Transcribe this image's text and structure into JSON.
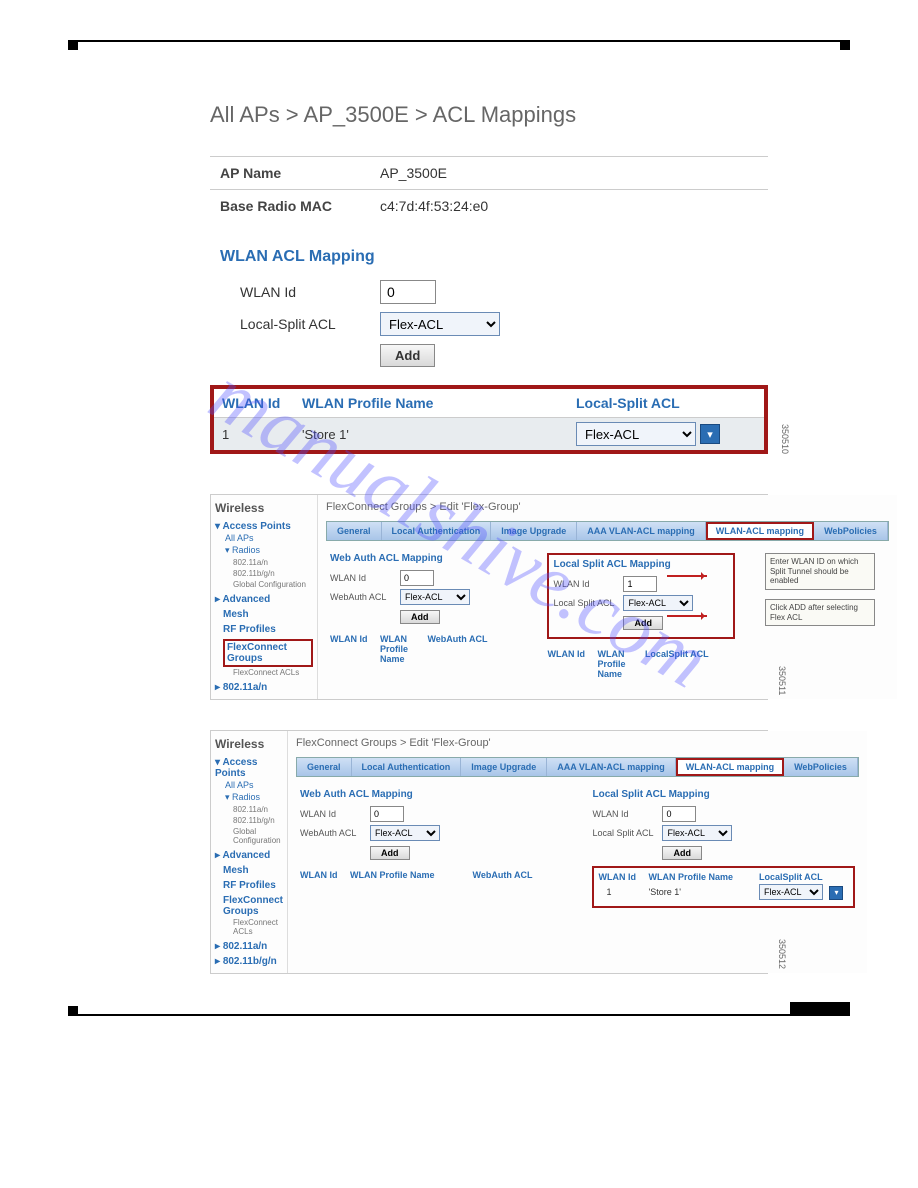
{
  "watermark": "manualshive.com",
  "shot1": {
    "breadcrumb": "All APs > AP_3500E > ACL Mappings",
    "info": {
      "ap_name_label": "AP Name",
      "ap_name_value": "AP_3500E",
      "mac_label": "Base Radio MAC",
      "mac_value": "c4:7d:4f:53:24:e0"
    },
    "section_title": "WLAN ACL Mapping",
    "wlan_id_label": "WLAN Id",
    "wlan_id_value": "0",
    "split_label": "Local-Split ACL",
    "split_value": "Flex-ACL",
    "add_btn": "Add",
    "table": {
      "h_id": "WLAN Id",
      "h_name": "WLAN Profile Name",
      "h_acl": "Local-Split ACL",
      "row": {
        "id": "1",
        "name": "'Store 1'",
        "acl": "Flex-ACL"
      }
    },
    "sidenum": "350510"
  },
  "side": {
    "title": "Wireless",
    "ap": "Access Points",
    "all_aps": "All APs",
    "radios": "Radios",
    "r1": "802.11a/n",
    "r2": "802.11b/g/n",
    "gc": "Global Configuration",
    "adv": "Advanced",
    "mesh": "Mesh",
    "rf": "RF Profiles",
    "fc": "FlexConnect Groups",
    "fca": "FlexConnect ACLs",
    "b1": "802.11a/n",
    "b2": "802.11b/g/n"
  },
  "panel2": {
    "breadcrumb": "FlexConnect Groups > Edit    'Flex-Group'",
    "tabs": [
      "General",
      "Local Authentication",
      "Image Upgrade",
      "AAA VLAN-ACL mapping",
      "WLAN-ACL mapping",
      "WebPolicies"
    ],
    "webauth": {
      "title": "Web Auth ACL Mapping",
      "wlan_id_label": "WLAN Id",
      "wlan_id_value": "0",
      "acl_label": "WebAuth ACL",
      "acl_value": "Flex-ACL",
      "add": "Add",
      "th": [
        "WLAN Id",
        "WLAN Profile Name",
        "WebAuth ACL"
      ]
    },
    "localsplit": {
      "title": "Local Split ACL Mapping",
      "wlan_id_label": "WLAN Id",
      "wlan_id_value": "1",
      "acl_label": "Local Split ACL",
      "acl_value": "Flex-ACL",
      "add": "Add",
      "th": [
        "WLAN Id",
        "WLAN Profile Name",
        "LocalSplit ACL"
      ]
    },
    "callout1": "Enter WLAN ID on which Split Tunnel should be enabled",
    "callout2": "Click ADD after selecting Flex ACL",
    "sidenum": "350511"
  },
  "panel3": {
    "breadcrumb": "FlexConnect Groups > Edit    'Flex-Group'",
    "localsplit": {
      "wlan_id_value": "0",
      "row": {
        "id": "1",
        "name": "'Store 1'",
        "acl": "Flex-ACL"
      }
    },
    "sidenum": "350512"
  }
}
